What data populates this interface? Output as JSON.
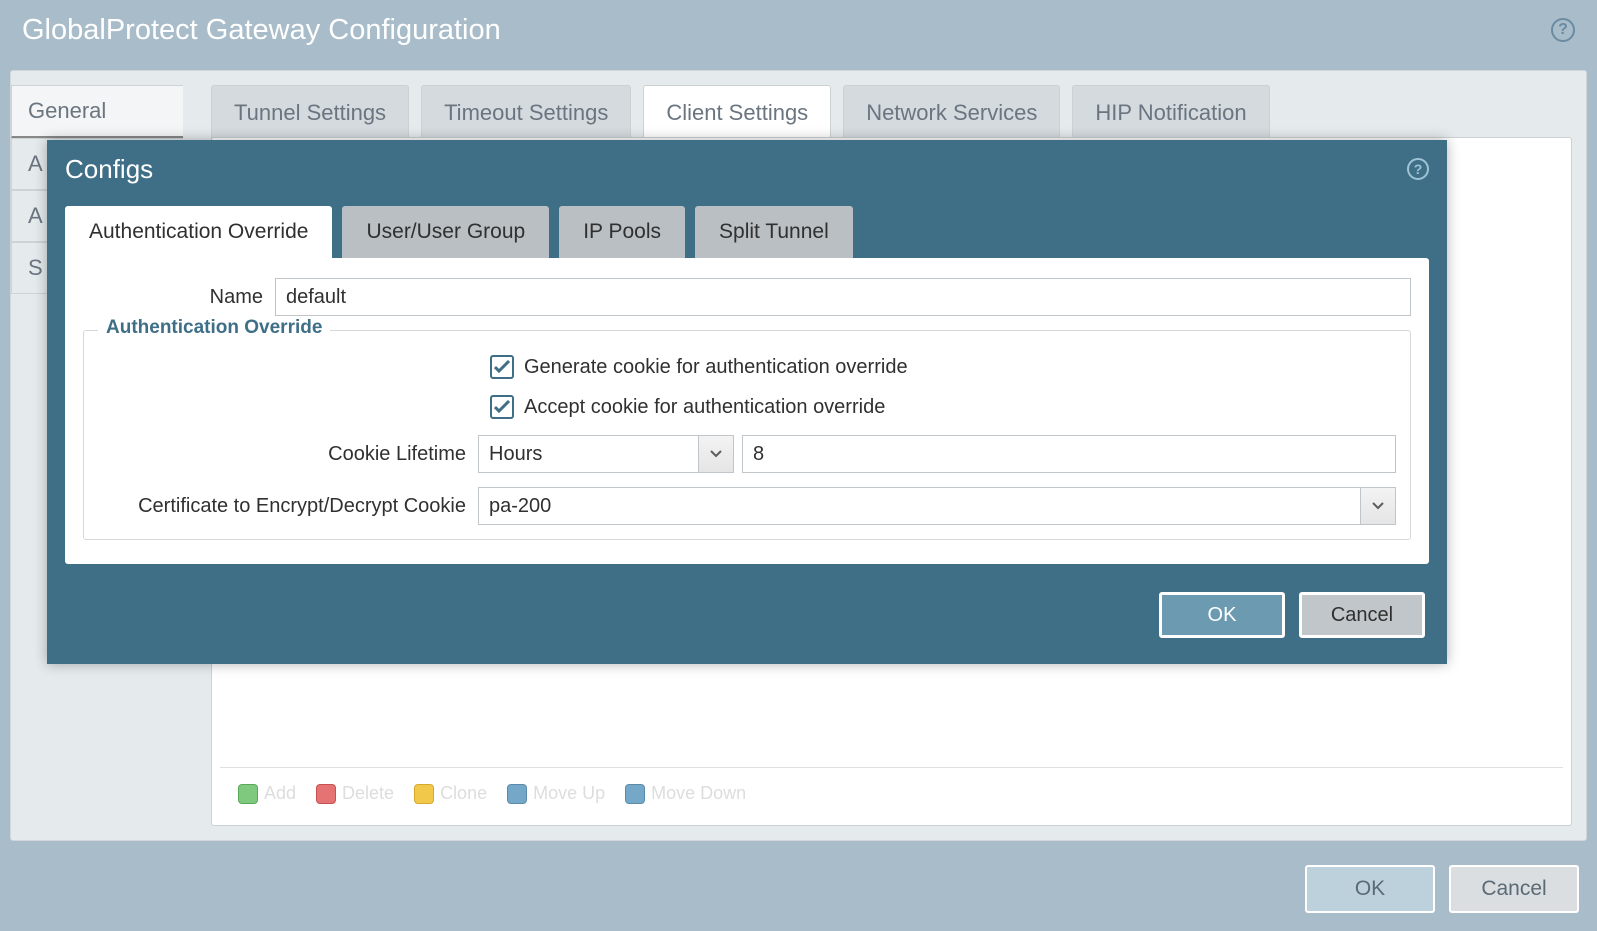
{
  "outer": {
    "title": "GlobalProtect Gateway Configuration",
    "sideTabs": [
      "General",
      "Authentication",
      "Agent",
      "Satellite"
    ],
    "sideTabsVisible": [
      "General",
      "A",
      "A",
      "S"
    ],
    "activeSideTab": 0,
    "topTabs": [
      "Tunnel Settings",
      "Timeout Settings",
      "Client Settings",
      "Network Services",
      "HIP Notification"
    ],
    "activeTopTab": 2,
    "toolbar": {
      "add": "Add",
      "delete": "Delete",
      "clone": "Clone",
      "moveUp": "Move Up",
      "moveDown": "Move Down"
    },
    "buttons": {
      "ok": "OK",
      "cancel": "Cancel"
    }
  },
  "modal": {
    "title": "Configs",
    "tabs": [
      "Authentication Override",
      "User/User Group",
      "IP Pools",
      "Split Tunnel"
    ],
    "activeTab": 0,
    "form": {
      "nameLabel": "Name",
      "nameValue": "default",
      "fieldsetLegend": "Authentication Override",
      "generateLabel": "Generate cookie for authentication override",
      "generateChecked": true,
      "acceptLabel": "Accept cookie for authentication override",
      "acceptChecked": true,
      "cookieLifetimeLabel": "Cookie Lifetime",
      "cookieLifetimeUnit": "Hours",
      "cookieLifetimeValue": "8",
      "certLabel": "Certificate to Encrypt/Decrypt Cookie",
      "certValue": "pa-200"
    },
    "buttons": {
      "ok": "OK",
      "cancel": "Cancel"
    }
  }
}
